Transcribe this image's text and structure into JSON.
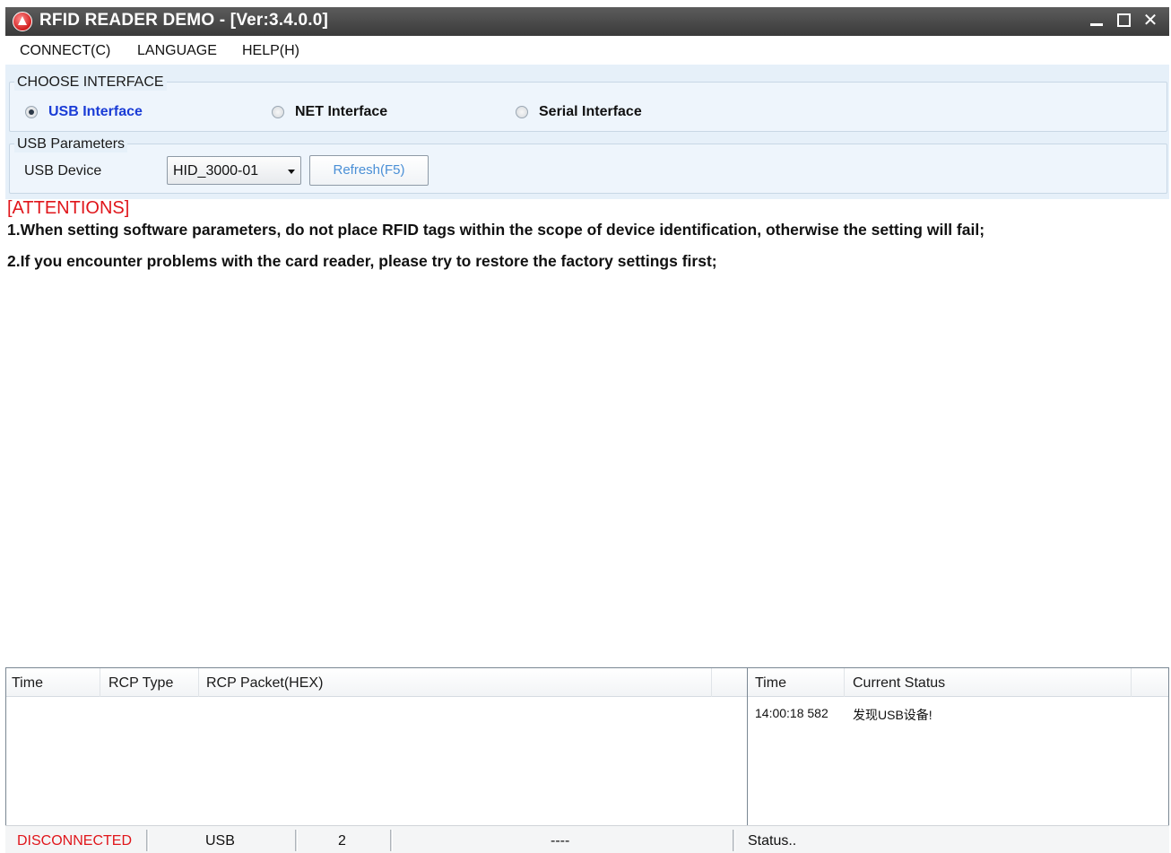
{
  "window": {
    "title": "RFID READER DEMO - [Ver:3.4.0.0]",
    "min_glyph": "_",
    "close_glyph": "✕"
  },
  "menu": {
    "items": [
      "CONNECT(C)",
      "LANGUAGE",
      "HELP(H)"
    ]
  },
  "choose_interface": {
    "label": "CHOOSE INTERFACE",
    "options": [
      {
        "label": "USB Interface",
        "selected": true
      },
      {
        "label": "NET Interface",
        "selected": false
      },
      {
        "label": "Serial Interface",
        "selected": false
      }
    ]
  },
  "usb_params": {
    "label": "USB Parameters",
    "device_label": "USB Device",
    "device_value": "HID_3000-01",
    "refresh_label": "Refresh(F5)"
  },
  "attentions": {
    "title": "[ATTENTIONS]",
    "lines": [
      "1.When setting software parameters, do not place RFID tags within the scope of device identification, otherwise the setting will fail;",
      "2.If you encounter problems with the card reader, please try to restore the factory settings first;"
    ]
  },
  "packet_log": {
    "columns": [
      "Time",
      "RCP Type",
      "RCP Packet(HEX)"
    ],
    "rows": []
  },
  "status_log": {
    "columns": [
      "Time",
      "Current Status"
    ],
    "rows": [
      {
        "time": "14:00:18 582",
        "status": "发现USB设备!"
      }
    ]
  },
  "statusbar": {
    "connection": "DISCONNECTED",
    "interface": "USB",
    "count": "2",
    "info": "----",
    "status": "Status.."
  },
  "colors": {
    "titlebar": "#3a3a3a",
    "panel_bg": "#e6f0f9",
    "attention_red": "#e0161b",
    "selected_blue": "#1a3cd6",
    "disconnected_red": "#e0161b",
    "button_text": "#4a8fd6"
  }
}
